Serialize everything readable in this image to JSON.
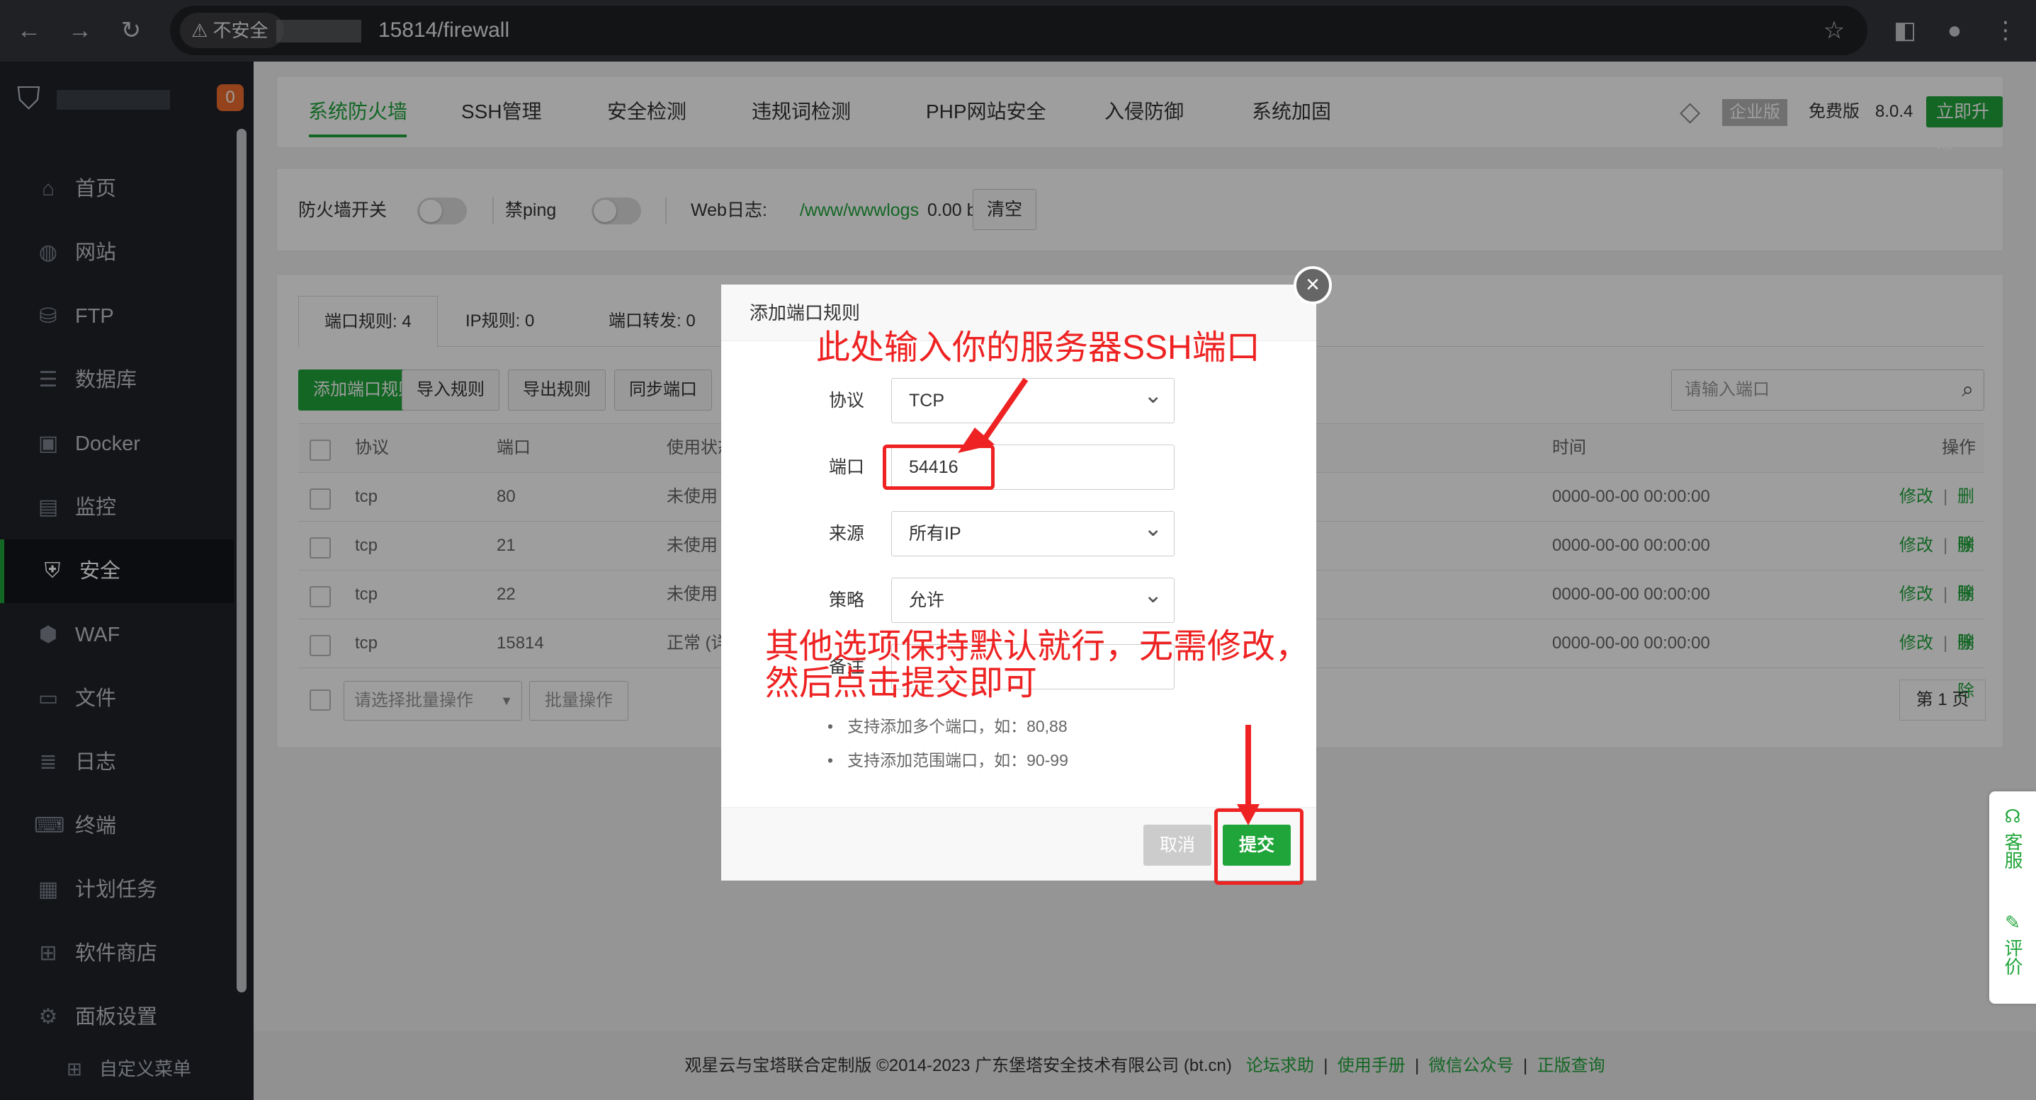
{
  "browser": {
    "security_chip": "不安全",
    "url": "15814/firewall"
  },
  "sidebar": {
    "badge": "0",
    "items": [
      {
        "label": "首页",
        "icon": "home-icon"
      },
      {
        "label": "网站",
        "icon": "globe-icon"
      },
      {
        "label": "FTP",
        "icon": "ftp-icon"
      },
      {
        "label": "数据库",
        "icon": "database-icon"
      },
      {
        "label": "Docker",
        "icon": "docker-icon"
      },
      {
        "label": "监控",
        "icon": "monitor-icon"
      },
      {
        "label": "安全",
        "icon": "shield-icon"
      },
      {
        "label": "WAF",
        "icon": "waf-icon"
      },
      {
        "label": "文件",
        "icon": "folder-icon"
      },
      {
        "label": "日志",
        "icon": "log-icon"
      },
      {
        "label": "终端",
        "icon": "terminal-icon"
      },
      {
        "label": "计划任务",
        "icon": "calendar-icon"
      },
      {
        "label": "软件商店",
        "icon": "apps-icon"
      },
      {
        "label": "面板设置",
        "icon": "gear-icon"
      }
    ],
    "active": "安全",
    "custom_menu": "自定义菜单"
  },
  "topnav": {
    "tabs": [
      "系统防火墙",
      "SSH管理",
      "安全检测",
      "违规词检测",
      "PHP网站安全",
      "入侵防御",
      "系统加固"
    ],
    "edition": "企业版",
    "free": "免费版",
    "version": "8.0.4",
    "upgrade": "立即升级"
  },
  "firewall": {
    "switch_label": "防火墙开关",
    "ping_label": "禁ping",
    "weblog_label": "Web日志:",
    "weblog_path": "/www/wwwlogs",
    "weblog_size": "0.00 b",
    "clear": "清空"
  },
  "rules": {
    "tabs": [
      "端口规则: 4",
      "IP规则: 0",
      "端口转发: 0"
    ],
    "buttons": [
      "添加端口规则",
      "导入规则",
      "导出规则",
      "同步端口"
    ],
    "search_placeholder": "请输入端口",
    "columns": [
      "协议",
      "端口",
      "使用状态",
      "时间",
      "操作"
    ],
    "rows": [
      {
        "proto": "tcp",
        "port": "80",
        "status": "未使用",
        "time": "0000-00-00 00:00:00"
      },
      {
        "proto": "tcp",
        "port": "21",
        "status": "未使用",
        "time": "0000-00-00 00:00:00"
      },
      {
        "proto": "tcp",
        "port": "22",
        "status": "未使用",
        "time": "0000-00-00 00:00:00"
      },
      {
        "proto": "tcp",
        "port": "15814",
        "status": "正常 (详",
        "time": "0000-00-00 00:00:00"
      }
    ],
    "edit": "修改",
    "delete": "删除",
    "batch_placeholder": "请选择批量操作",
    "batch_button": "批量操作",
    "page": "第 1 页"
  },
  "modal": {
    "title": "添加端口规则",
    "protocol_label": "协议",
    "protocol_value": "TCP",
    "port_label": "端口",
    "port_value": "54416",
    "source_label": "来源",
    "source_value": "所有IP",
    "policy_label": "策略",
    "policy_value": "允许",
    "remark_label": "备注",
    "hints": [
      "支持添加多个端口，如：80,88",
      "支持添加范围端口，如：90-99"
    ],
    "cancel": "取消",
    "submit": "提交"
  },
  "annotations": {
    "top": "此处输入你的服务器SSH端口",
    "bottom_line1": "其他选项保持默认就行，无需修改，",
    "bottom_line2": "然后点击提交即可"
  },
  "float": {
    "service": "客服",
    "review": "评价"
  },
  "footer": {
    "copyright": "观星云与宝塔联合定制版 ©2014-2023 广东堡塔安全技术有限公司 (bt.cn)",
    "links": [
      "论坛求助",
      "使用手册",
      "微信公众号",
      "正版查询"
    ]
  },
  "colors": {
    "accent": "#20a53a",
    "annotation": "#e22222",
    "sidebar_bg": "#1f2329"
  }
}
